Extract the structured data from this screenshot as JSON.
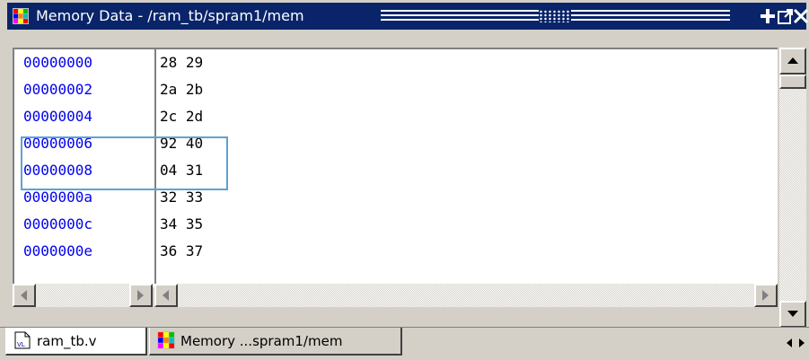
{
  "window": {
    "title": "Memory Data - /ram_tb/spram1/mem",
    "controls": [
      "add-pane-icon",
      "undock-icon",
      "close-icon"
    ]
  },
  "memory": {
    "rows": [
      {
        "address": "00000000",
        "values": "28 29"
      },
      {
        "address": "00000002",
        "values": "2a 2b"
      },
      {
        "address": "00000004",
        "values": "2c 2d"
      },
      {
        "address": "00000006",
        "values": "92 40"
      },
      {
        "address": "00000008",
        "values": "04 31"
      },
      {
        "address": "0000000a",
        "values": "32 33"
      },
      {
        "address": "0000000c",
        "values": "34 35"
      },
      {
        "address": "0000000e",
        "values": "36 37"
      }
    ],
    "highlighted_rows": [
      3,
      4
    ]
  },
  "tabs": [
    {
      "label": "ram_tb.v",
      "icon": "verilog-file-icon",
      "active": true
    },
    {
      "label": "Memory ...spram1/mem",
      "icon": "memory-grid-icon",
      "active": false
    }
  ],
  "colors": {
    "titlebar": "#0a246a",
    "address_text": "#0000ee",
    "highlight_border": "#5fa2d1"
  }
}
